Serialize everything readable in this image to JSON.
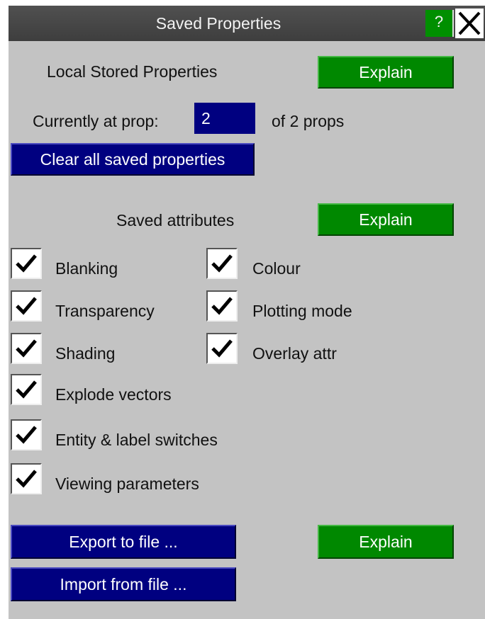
{
  "window": {
    "title": "Saved Properties",
    "help_label": "?"
  },
  "local": {
    "heading": "Local Stored Properties",
    "explain_label": "Explain",
    "current_label": "Currently at prop:",
    "current_value": "2",
    "total_text": "of 2 props",
    "clear_label": "Clear all saved properties"
  },
  "attributes": {
    "heading": "Saved attributes",
    "explain_label": "Explain",
    "items": [
      {
        "label": "Blanking",
        "checked": true
      },
      {
        "label": "Colour",
        "checked": true
      },
      {
        "label": "Transparency",
        "checked": true
      },
      {
        "label": "Plotting mode",
        "checked": true
      },
      {
        "label": "Shading",
        "checked": true
      },
      {
        "label": "Overlay attr",
        "checked": true
      },
      {
        "label": "Explode vectors",
        "checked": true
      },
      {
        "label": "Entity & label switches",
        "checked": true
      },
      {
        "label": "Viewing parameters",
        "checked": true
      }
    ]
  },
  "file": {
    "export_label": "Export to file ...",
    "import_label": "Import from file ...",
    "explain_label": "Explain"
  },
  "colors": {
    "title_bar": "#474747",
    "panel": "#c3c3c3",
    "green_button": "#008800",
    "blue_button": "#000080"
  }
}
